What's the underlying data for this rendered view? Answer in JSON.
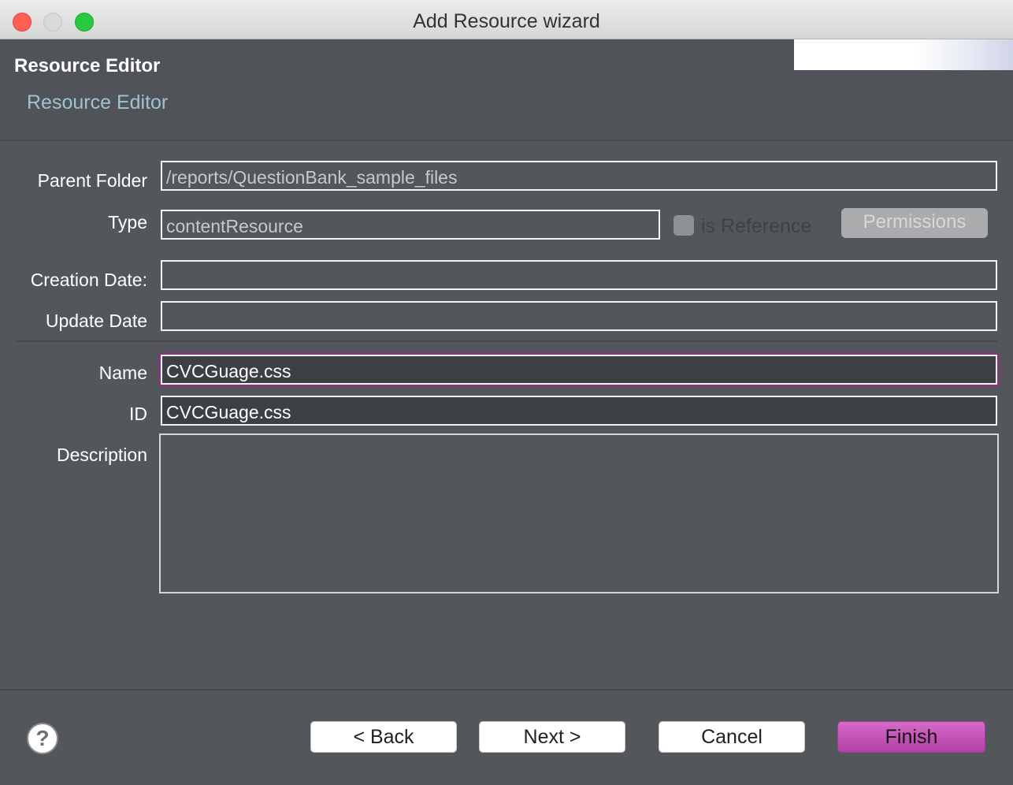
{
  "window": {
    "title": "Add Resource wizard"
  },
  "banner": {
    "title": "Resource Editor",
    "subtitle": "Resource Editor"
  },
  "form": {
    "parent_folder": {
      "label": "Parent Folder",
      "value": "/reports/QuestionBank_sample_files"
    },
    "type": {
      "label": "Type",
      "value": "contentResource"
    },
    "is_reference": {
      "label": "is Reference",
      "checked": false
    },
    "permissions_label": "Permissions",
    "creation_date": {
      "label": "Creation Date:",
      "value": ""
    },
    "update_date": {
      "label": "Update Date",
      "value": ""
    },
    "name": {
      "label": "Name",
      "value": "CVCGuage.css"
    },
    "id": {
      "label": "ID",
      "value": "CVCGuage.css"
    },
    "description": {
      "label": "Description",
      "value": ""
    }
  },
  "footer": {
    "help_glyph": "?",
    "back_label": "< Back",
    "next_label": "Next >",
    "cancel_label": "Cancel",
    "finish_label": "Finish"
  },
  "colors": {
    "background": "#53575b",
    "accent_finish": "#c455b7",
    "subtitle": "#9fc2d3",
    "focus_ring": "#7c3a78"
  }
}
